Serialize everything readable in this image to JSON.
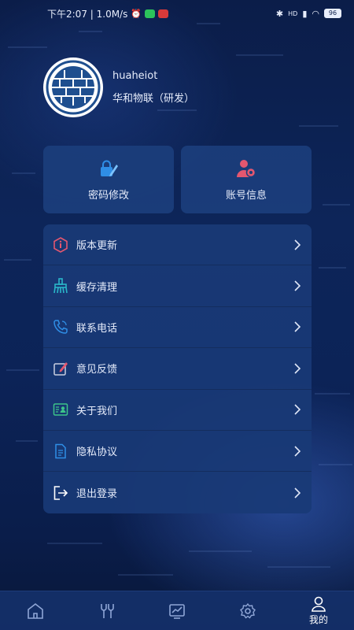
{
  "status_bar": {
    "time_network": "下午2:07 | 1.0M/s",
    "right_hd": "HD",
    "battery": "96"
  },
  "profile": {
    "username": "huaheiot",
    "org": "华和物联（研发）"
  },
  "cards": [
    {
      "label": "密码修改",
      "icon": "lock-edit-icon"
    },
    {
      "label": "账号信息",
      "icon": "user-settings-icon"
    }
  ],
  "menu": {
    "items": [
      {
        "label": "版本更新",
        "icon": "info-icon"
      },
      {
        "label": "缓存清理",
        "icon": "broom-icon"
      },
      {
        "label": "联系电话",
        "icon": "phone-icon"
      },
      {
        "label": "意见反馈",
        "icon": "feedback-icon"
      },
      {
        "label": "关于我们",
        "icon": "id-card-icon"
      },
      {
        "label": "隐私协议",
        "icon": "document-icon"
      },
      {
        "label": "退出登录",
        "icon": "logout-icon"
      }
    ]
  },
  "tabbar": {
    "mine_label": "我的"
  },
  "colors": {
    "accent_blue": "#2f8ee6",
    "accent_pink": "#e4576f",
    "accent_cyan": "#2ab6c9",
    "background": "#0c2357"
  }
}
